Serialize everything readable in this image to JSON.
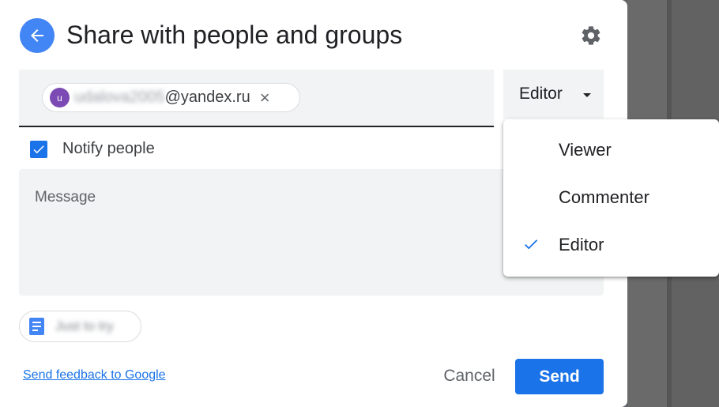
{
  "dialog": {
    "title": "Share with people and groups"
  },
  "recipient": {
    "avatar_letter": "u",
    "username": "udalova2005",
    "domain": "@yandex.ru",
    "remove_glyph": "×"
  },
  "role": {
    "selected": "Editor",
    "options": [
      {
        "label": "Viewer",
        "checked": false
      },
      {
        "label": "Commenter",
        "checked": false
      },
      {
        "label": "Editor",
        "checked": true
      }
    ]
  },
  "notify": {
    "label": "Notify people",
    "checked": true
  },
  "message": {
    "placeholder": "Message"
  },
  "attachment": {
    "label": "Just to try",
    "icon": "document-icon"
  },
  "footer": {
    "feedback_link": "Send feedback to Google",
    "cancel_label": "Cancel",
    "send_label": "Send"
  },
  "icons": {
    "back": "arrow-back-icon",
    "settings": "gear-icon",
    "checkbox": "check-icon",
    "dropdown": "caret-down-icon"
  },
  "colors": {
    "accent": "#1a73e8",
    "back_button": "#4285f4",
    "avatar": "#7b4bb3",
    "field_bg": "#f1f3f4"
  }
}
